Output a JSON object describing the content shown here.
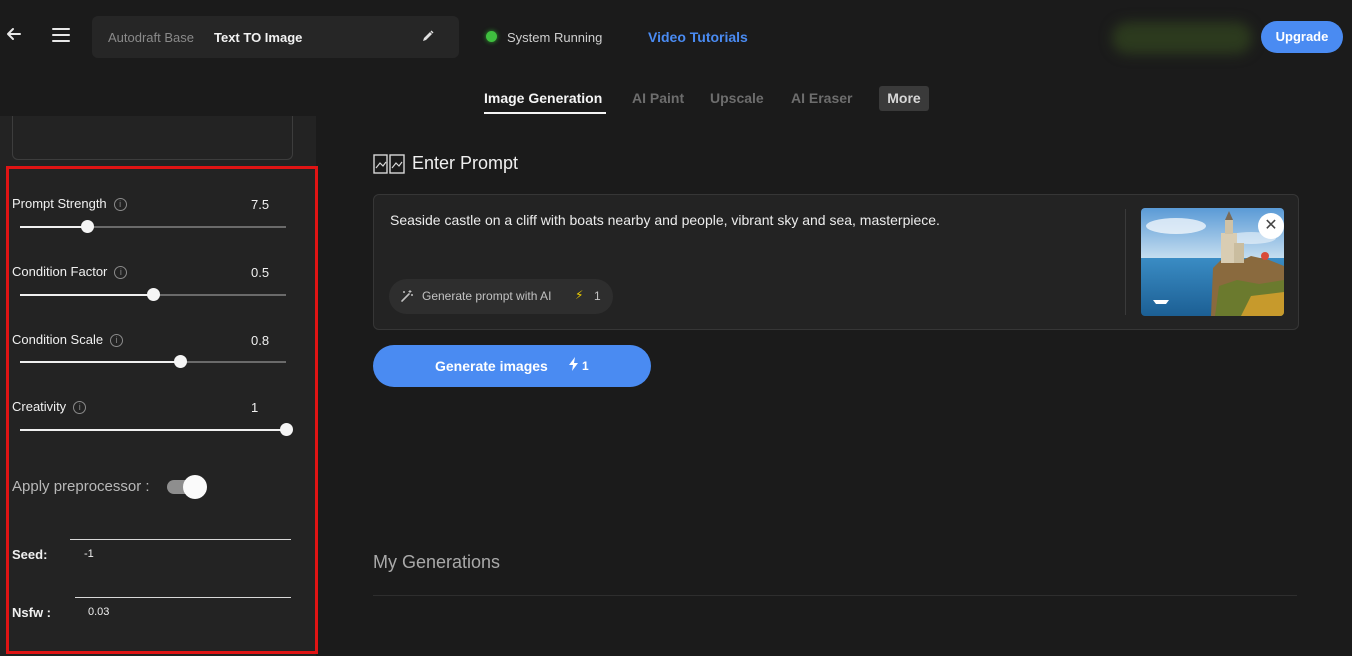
{
  "header": {
    "back_icon": "arrow-left-icon",
    "menu_icon": "hamburger-menu-icon",
    "project_base": "Autodraft Base",
    "project_name": "Text TO Image",
    "edit_icon": "pencil-icon",
    "status": "System Running",
    "status_color": "#3fbf3f",
    "tutorials": "Video Tutorials",
    "upgrade": "Upgrade",
    "accent_color": "#4a8bf2"
  },
  "tabs": [
    {
      "label": "Image Generation",
      "active": true
    },
    {
      "label": "AI Paint",
      "active": false
    },
    {
      "label": "Upscale",
      "active": false
    },
    {
      "label": "AI Eraser",
      "active": false
    },
    {
      "label": "More",
      "active": false
    }
  ],
  "sidebar": {
    "sliders": [
      {
        "label": "Prompt Strength",
        "value": "7.5",
        "fraction": 0.25
      },
      {
        "label": "Condition Factor",
        "value": "0.5",
        "fraction": 0.5
      },
      {
        "label": "Condition Scale",
        "value": "0.8",
        "fraction": 0.6
      },
      {
        "label": "Creativity",
        "value": "1",
        "fraction": 1.0
      }
    ],
    "preprocessor_label": "Apply preprocessor :",
    "preprocessor_on": true,
    "seed_label": "Seed:",
    "seed_value": "-1",
    "nsfw_label": "Nsfw :",
    "nsfw_value": "0.03",
    "highlight_color": "#e01414"
  },
  "main": {
    "prompt_title": "Enter Prompt",
    "prompt_text": "Seaside castle on a cliff with boats nearby and people, vibrant sky and sea, masterpiece.",
    "ai_button": "Generate prompt with AI",
    "ai_cost": "1",
    "generate_button": "Generate images",
    "generate_cost": "1",
    "my_generations": "My Generations"
  }
}
